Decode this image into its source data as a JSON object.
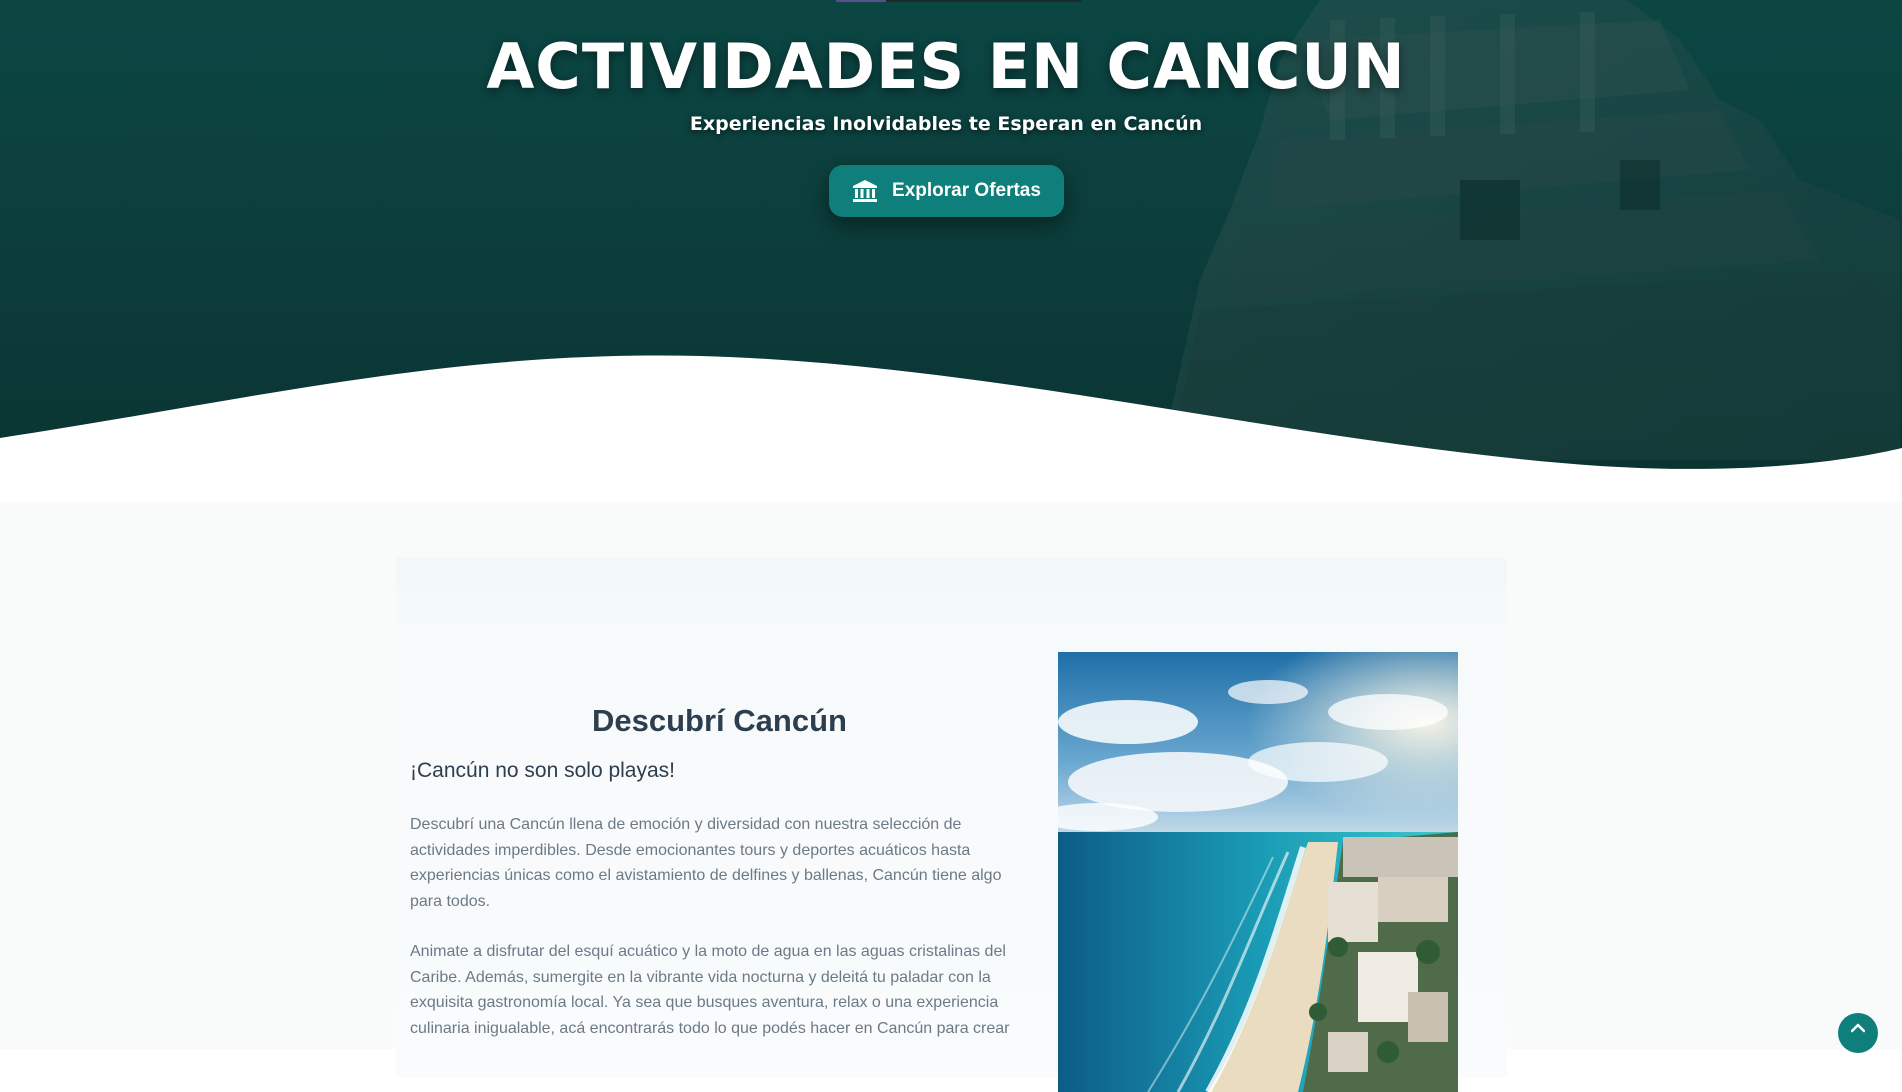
{
  "hero": {
    "title": "ACTIVIDADES EN CANCUN",
    "subtitle": "Experiencias Inolvidables te Esperan en Cancún",
    "cta_label": "Explorar Ofertas",
    "cta_icon": "bank-icon",
    "background_image": "mayan-ruin-temple"
  },
  "intro": {
    "title": "Descubrí Cancún",
    "lead": "¡Cancún no son solo playas!",
    "paragraphs": [
      "Descubrí una Cancún llena de emoción y diversidad con nuestra selección de actividades imperdibles. Desde emocionantes tours y deportes acuáticos hasta experiencias únicas como el avistamiento de delfines y ballenas, Cancún tiene algo para todos.",
      "Animate a disfrutar del esquí acuático y la moto de agua en las aguas cristalinas del Caribe. Además, sumergite en la vibrante vida nocturna y deleitá tu paladar con la exquisita gastronomía local. Ya sea que busques aventura, relax o una experiencia culinaria inigualable, acá encontrarás todo lo que podés hacer en Cancún para crear"
    ],
    "photo": "cancun-aerial-beach-photo"
  },
  "scroll_top_icon": "chevron-up-icon",
  "colors": {
    "hero_bg": "#0b4643",
    "accent": "#0e7f7a",
    "heading": "#2d3e4e",
    "body_text": "#6c7a86"
  }
}
